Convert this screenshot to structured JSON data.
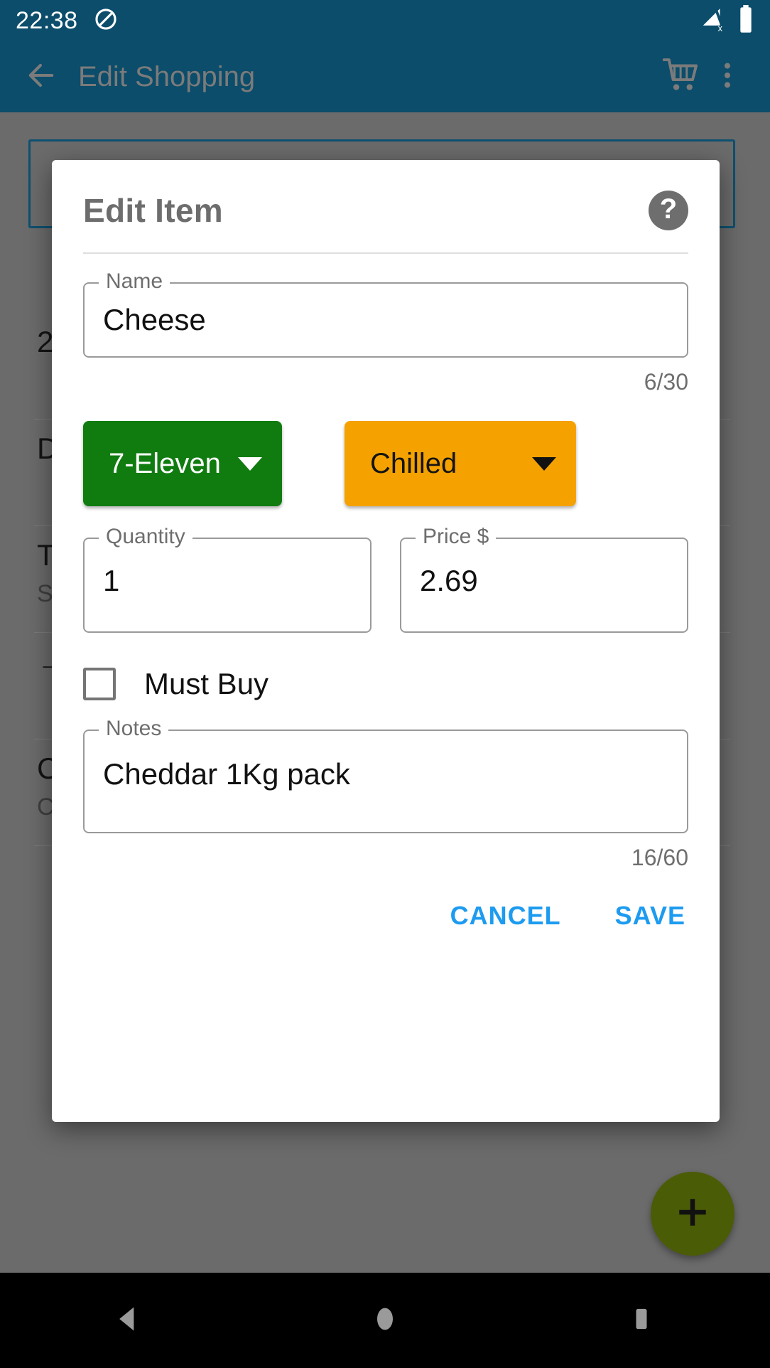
{
  "status_bar": {
    "clock": "22:38",
    "icons": {
      "notification": "do-not-disturb-icon",
      "signal": "no-sim-signal-icon",
      "battery": "battery-full-icon"
    }
  },
  "app_bar": {
    "back": "back-arrow-icon",
    "title": "Edit Shopping",
    "cart": "shopping-cart-icon",
    "overflow": "more-vert-icon"
  },
  "background": {
    "rows": [
      {
        "title": "2",
        "sub": ""
      },
      {
        "title": "D",
        "sub": ""
      },
      {
        "title": "T",
        "sub": "S"
      },
      {
        "title": "→",
        "sub": ""
      },
      {
        "title": "C",
        "sub": "C"
      }
    ],
    "fab_label": "+"
  },
  "dialog": {
    "title": "Edit Item",
    "help_icon_label": "?",
    "name_field": {
      "label": "Name",
      "value": "Cheese",
      "placeholder": "Name",
      "counter": "6/30"
    },
    "store_spinner": {
      "value": "7-Eleven",
      "color": "#107c10",
      "text_color": "#ffffff"
    },
    "category_spinner": {
      "value": "Chilled",
      "color": "#f5a200",
      "text_color": "#141414"
    },
    "quantity_field": {
      "label": "Quantity",
      "value": "1",
      "placeholder": "Quantity"
    },
    "price_field": {
      "label": "Price $",
      "value": "2.69",
      "placeholder": "Price $"
    },
    "must_buy": {
      "label": "Must Buy",
      "checked": false
    },
    "notes_field": {
      "label": "Notes",
      "value": "Cheddar 1Kg pack",
      "placeholder": "Notes",
      "counter": "16/60"
    },
    "cancel_label": "CANCEL",
    "save_label": "SAVE",
    "accent_color": "#1d9bf0"
  },
  "nav_bar": {
    "back": "triangle-back-icon",
    "home": "circle-home-icon",
    "recents": "square-recents-icon"
  }
}
